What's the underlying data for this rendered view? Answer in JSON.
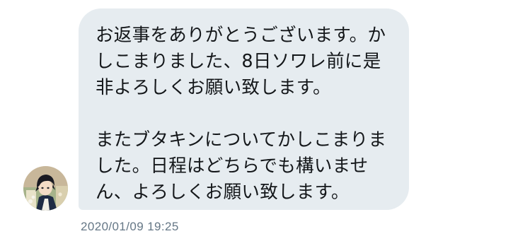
{
  "message": {
    "text": "お返事をありがとうございます。か\nしこまりました、8日ソワレ前に是\n非よろしくお願い致します。\n\nまたブタキンについてかしこまりま\nした。日程はどちらでも構いませ\nん、よろしくお願い致します。",
    "bubble_color": "#e6ecf0",
    "text_color": "#14171a",
    "timestamp": "2020/01/09 19:25",
    "timestamp_color": "#657786"
  },
  "sender": {
    "avatar_icon": "user-avatar-icon"
  }
}
